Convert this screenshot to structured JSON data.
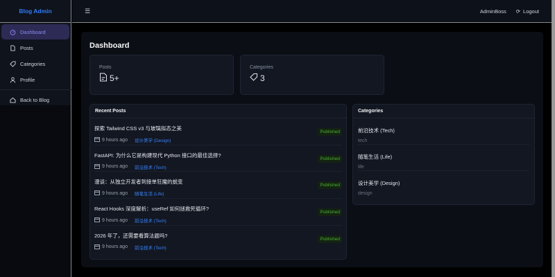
{
  "brand": "Blog Admin",
  "sidebar": {
    "items": [
      {
        "label": "Dashboard",
        "icon": "dashboard-icon"
      },
      {
        "label": "Posts",
        "icon": "file-icon"
      },
      {
        "label": "Categories",
        "icon": "tag-icon"
      },
      {
        "label": "Profile",
        "icon": "user-icon"
      },
      {
        "label": "Back to Blog",
        "icon": "home-icon"
      }
    ]
  },
  "header": {
    "user": "AdminBoss",
    "logout": "Logout"
  },
  "main": {
    "title": "Dashboard",
    "stats": [
      {
        "label": "Posts",
        "value": "5+"
      },
      {
        "label": "Categories",
        "value": "3"
      }
    ],
    "recent_posts": {
      "title": "Recent Posts",
      "items": [
        {
          "title": "探索 Tailwind CSS v3 与玻璃拟态之美",
          "time": "9 hours ago",
          "category": "设计美学 (Design)",
          "status": "Published"
        },
        {
          "title": "FastAPI: 为什么它是构建现代 Python 接口的最佳选择?",
          "time": "9 hours ago",
          "category": "前沿技术 (Tech)",
          "status": "Published"
        },
        {
          "title": "漫谈：从独立开发者到接单狂魔的蜕变",
          "time": "9 hours ago",
          "category": "随笔生活 (Life)",
          "status": "Published"
        },
        {
          "title": "React Hooks 深度解析：useRef 如何拯救死循环?",
          "time": "9 hours ago",
          "category": "前沿技术 (Tech)",
          "status": "Published"
        },
        {
          "title": "2026 年了，还需要看算法题吗?",
          "time": "9 hours ago",
          "category": "前沿技术 (Tech)",
          "status": "Published"
        }
      ]
    },
    "categories": {
      "title": "Categories",
      "items": [
        {
          "name": "前沿技术 (Tech)",
          "slug": "tech"
        },
        {
          "name": "随笔生活 (Life)",
          "slug": "life"
        },
        {
          "name": "设计美学 (Design)",
          "slug": "design"
        }
      ]
    }
  }
}
